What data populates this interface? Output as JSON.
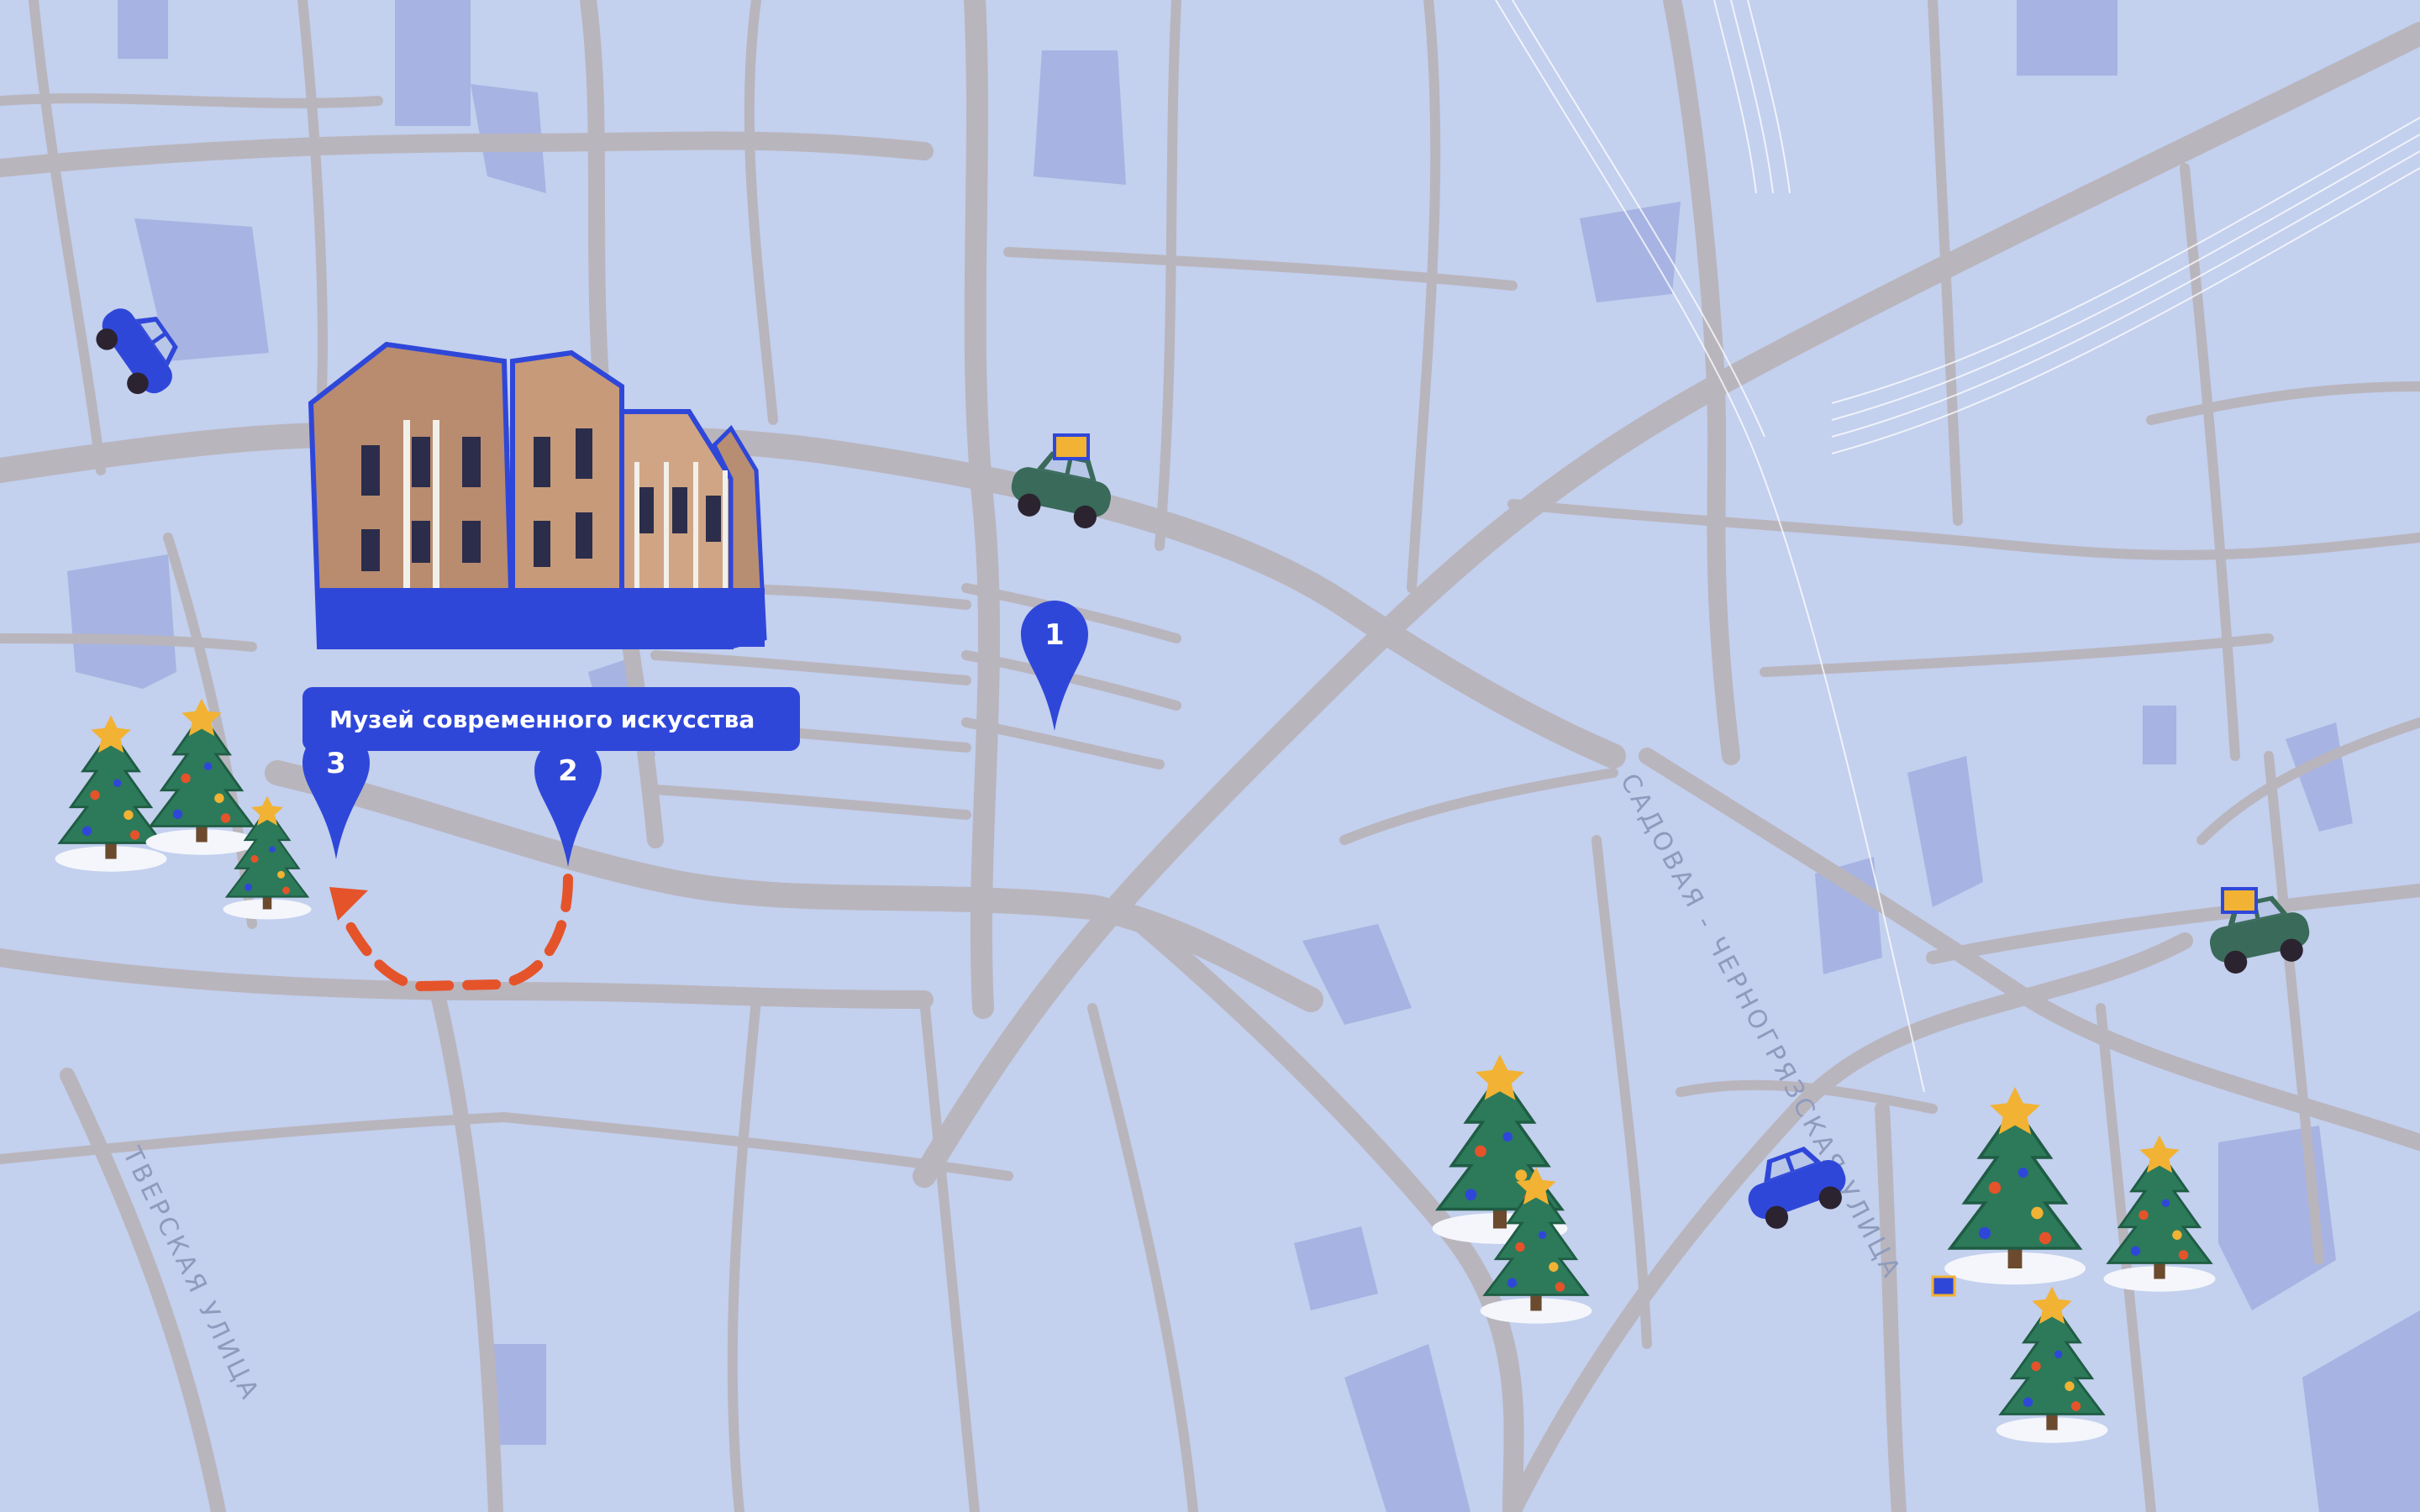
{
  "museum": {
    "label": "Музей современного искусства"
  },
  "markers": [
    {
      "number": "1"
    },
    {
      "number": "2"
    },
    {
      "number": "3"
    }
  ],
  "streets": [
    {
      "name": "САДОВАЯ - ЧЕРНОГРЯЗСКАЯ УЛИЦА"
    },
    {
      "name": "ТВЕРСКАЯ УЛИЦА"
    }
  ],
  "colors": {
    "background": "#c3d0ee",
    "road": "#b9b5bd",
    "block": "#a7b3e2",
    "marker": "#2f47d9",
    "route": "#e5532a",
    "tree": "#2c7a5a",
    "car_blue": "#2f47d9",
    "car_green": "#3a6a5a"
  },
  "icons": [
    "museum-building-icon",
    "christmas-tree-icon",
    "car-icon",
    "gift-car-icon",
    "location-pin-icon"
  ]
}
